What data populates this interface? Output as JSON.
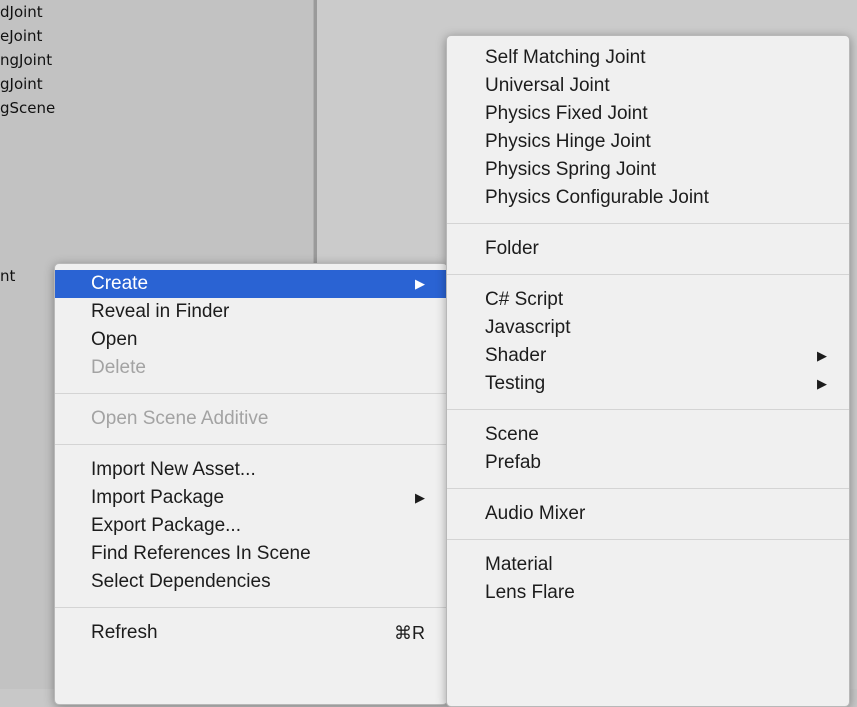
{
  "project_list": [
    "dJoint",
    "eJoint",
    "ngJoint",
    "gJoint",
    "gScene"
  ],
  "partial_row": "nt",
  "context_menu": {
    "items": [
      {
        "label": "Create",
        "arrow": "▶",
        "selected": true
      },
      {
        "label": "Reveal in Finder"
      },
      {
        "label": "Open"
      },
      {
        "label": "Delete",
        "disabled": true
      },
      {
        "sep": true
      },
      {
        "label": "Open Scene Additive",
        "disabled": true
      },
      {
        "sep": true
      },
      {
        "label": "Import New Asset..."
      },
      {
        "label": "Import Package",
        "arrow": "▶"
      },
      {
        "label": "Export Package..."
      },
      {
        "label": "Find References In Scene"
      },
      {
        "label": "Select Dependencies"
      },
      {
        "sep": true
      },
      {
        "label": "Refresh",
        "shortcut": "⌘R"
      }
    ]
  },
  "create_submenu": {
    "items": [
      {
        "label": "Self Matching Joint"
      },
      {
        "label": "Universal Joint"
      },
      {
        "label": "Physics Fixed Joint"
      },
      {
        "label": "Physics Hinge Joint"
      },
      {
        "label": "Physics Spring Joint"
      },
      {
        "label": "Physics Configurable Joint"
      },
      {
        "sep": true
      },
      {
        "label": "Folder"
      },
      {
        "sep": true
      },
      {
        "label": "C# Script"
      },
      {
        "label": "Javascript"
      },
      {
        "label": "Shader",
        "arrow": "▶"
      },
      {
        "label": "Testing",
        "arrow": "▶"
      },
      {
        "sep": true
      },
      {
        "label": "Scene"
      },
      {
        "label": "Prefab"
      },
      {
        "sep": true
      },
      {
        "label": "Audio Mixer"
      },
      {
        "sep": true
      },
      {
        "label": "Material"
      },
      {
        "label": "Lens Flare"
      }
    ]
  }
}
